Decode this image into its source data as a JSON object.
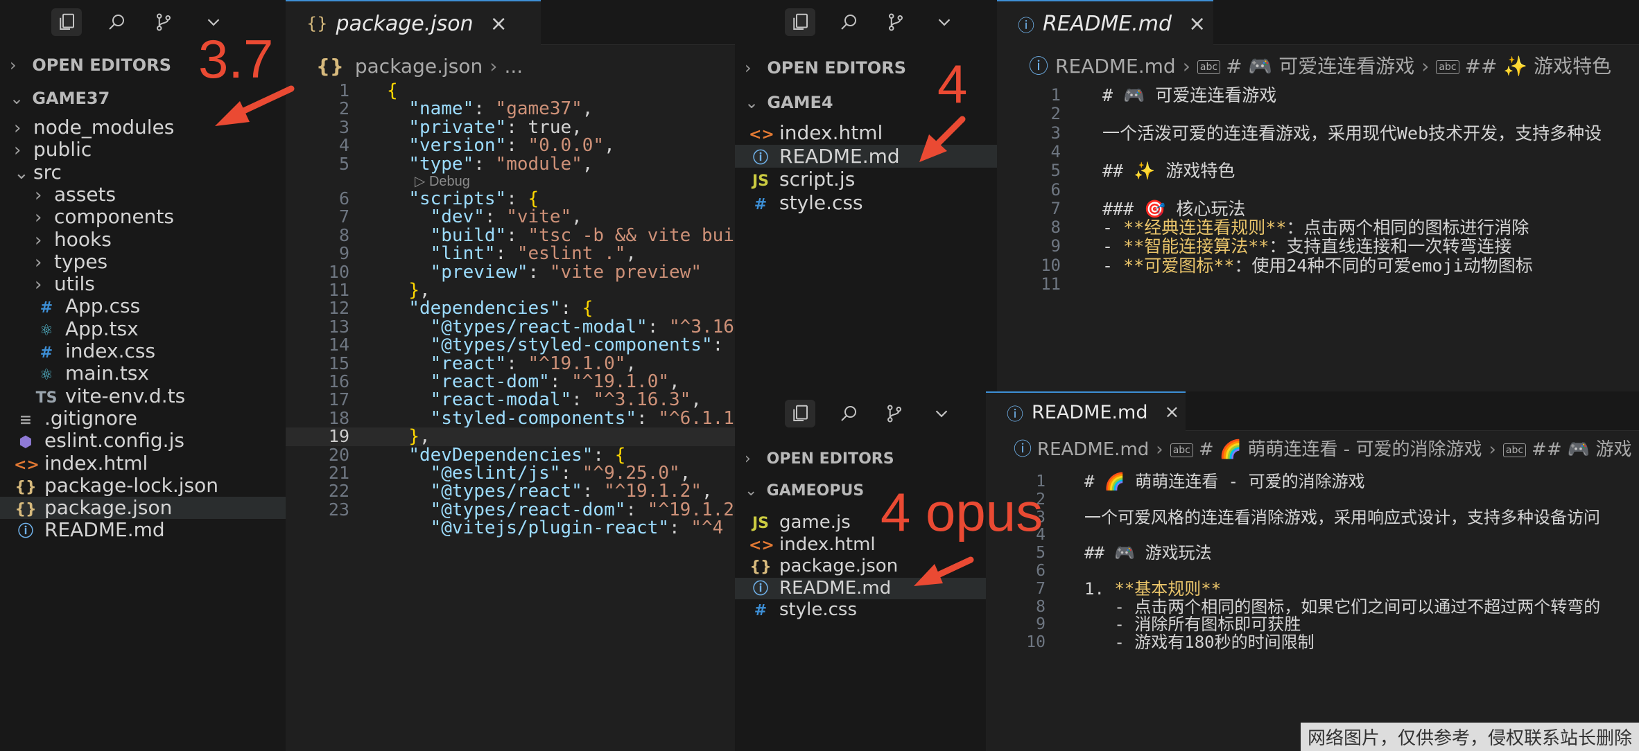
{
  "explorer_left": {
    "open_editors": "OPEN EDITORS",
    "project": "GAME37",
    "rows": [
      {
        "label": "node_modules",
        "icon": "chevron-right",
        "indent": 1
      },
      {
        "label": "public",
        "icon": "chevron-right",
        "indent": 1
      },
      {
        "label": "src",
        "icon": "chevron-down",
        "indent": 1
      },
      {
        "label": "assets",
        "icon": "chevron-right",
        "indent": 2
      },
      {
        "label": "components",
        "icon": "chevron-right",
        "indent": 2
      },
      {
        "label": "hooks",
        "icon": "chevron-right",
        "indent": 2
      },
      {
        "label": "types",
        "icon": "chevron-right",
        "indent": 2
      },
      {
        "label": "utils",
        "icon": "chevron-right",
        "indent": 2
      },
      {
        "label": "App.css",
        "icon": "css",
        "indent": 2
      },
      {
        "label": "App.tsx",
        "icon": "react",
        "indent": 2
      },
      {
        "label": "index.css",
        "icon": "css",
        "indent": 2
      },
      {
        "label": "main.tsx",
        "icon": "react",
        "indent": 2
      },
      {
        "label": "vite-env.d.ts",
        "icon": "ts",
        "indent": 2
      },
      {
        "label": ".gitignore",
        "icon": "lines",
        "indent": 1
      },
      {
        "label": "eslint.config.js",
        "icon": "eslint",
        "indent": 1
      },
      {
        "label": "index.html",
        "icon": "html",
        "indent": 1
      },
      {
        "label": "package-lock.json",
        "icon": "json",
        "indent": 1
      },
      {
        "label": "package.json",
        "icon": "json",
        "indent": 1,
        "selected": true
      },
      {
        "label": "README.md",
        "icon": "info",
        "indent": 1
      }
    ]
  },
  "editor_left": {
    "tab": "package.json",
    "breadcrumb": [
      "package.json",
      "..."
    ],
    "codelens": "Debug",
    "lines": [
      {
        "n": "1",
        "t": "{"
      },
      {
        "n": "2",
        "t": "  \"name\": \"game37\","
      },
      {
        "n": "3",
        "t": "  \"private\": true,"
      },
      {
        "n": "4",
        "t": "  \"version\": \"0.0.0\","
      },
      {
        "n": "5",
        "t": "  \"type\": \"module\","
      },
      {
        "n": "6",
        "t": "  \"scripts\": {"
      },
      {
        "n": "7",
        "t": "    \"dev\": \"vite\","
      },
      {
        "n": "8",
        "t": "    \"build\": \"tsc -b && vite bui"
      },
      {
        "n": "9",
        "t": "    \"lint\": \"eslint .\","
      },
      {
        "n": "10",
        "t": "    \"preview\": \"vite preview\""
      },
      {
        "n": "11",
        "t": "  },"
      },
      {
        "n": "12",
        "t": "  \"dependencies\": {"
      },
      {
        "n": "13",
        "t": "    \"@types/react-modal\": \"^3.16"
      },
      {
        "n": "14",
        "t": "    \"@types/styled-components\":"
      },
      {
        "n": "15",
        "t": "    \"react\": \"^19.1.0\","
      },
      {
        "n": "16",
        "t": "    \"react-dom\": \"^19.1.0\","
      },
      {
        "n": "17",
        "t": "    \"react-modal\": \"^3.16.3\","
      },
      {
        "n": "18",
        "t": "    \"styled-components\": \"^6.1.1"
      },
      {
        "n": "19",
        "t": "  },"
      },
      {
        "n": "20",
        "t": "  \"devDependencies\": {"
      },
      {
        "n": "21",
        "t": "    \"@eslint/js\": \"^9.25.0\","
      },
      {
        "n": "22",
        "t": "    \"@types/react\": \"^19.1.2\","
      },
      {
        "n": "23",
        "t": "    \"@types/react-dom\": \"^19.1.2"
      },
      {
        "n": "",
        "t": "    \"@vitejs/plugin-react\": \"^4"
      }
    ]
  },
  "explorer_top": {
    "open_editors": "OPEN EDITORS",
    "project": "GAME4",
    "rows": [
      {
        "label": "index.html",
        "icon": "html"
      },
      {
        "label": "README.md",
        "icon": "info",
        "selected": true
      },
      {
        "label": "script.js",
        "icon": "js"
      },
      {
        "label": "style.css",
        "icon": "css"
      }
    ]
  },
  "editor_top": {
    "tab": "README.md",
    "breadcrumb": [
      "README.md",
      "# 🎮 可爱连连看游戏",
      "## ✨ 游戏特色"
    ],
    "lines": [
      {
        "n": "1",
        "t": "# 🎮 可爱连连看游戏"
      },
      {
        "n": "2",
        "t": ""
      },
      {
        "n": "3",
        "t": "一个活泼可爱的连连看游戏，采用现代Web技术开发，支持多种设"
      },
      {
        "n": "4",
        "t": ""
      },
      {
        "n": "5",
        "t": "## ✨ 游戏特色"
      },
      {
        "n": "6",
        "t": ""
      },
      {
        "n": "7",
        "t": "### 🎯 核心玩法"
      },
      {
        "n": "8",
        "pre": "- ",
        "b": "**经典连连看规则**",
        "post": "：点击两个相同的图标进行消除"
      },
      {
        "n": "9",
        "pre": "- ",
        "b": "**智能连接算法**",
        "post": "：支持直线连接和一次转弯连接"
      },
      {
        "n": "10",
        "pre": "- ",
        "b": "**可爱图标**",
        "post": "：使用24种不同的可爱emoji动物图标"
      },
      {
        "n": "11",
        "t": ""
      }
    ]
  },
  "explorer_bottom": {
    "open_editors": "OPEN EDITORS",
    "project": "GAMEOPUS",
    "rows": [
      {
        "label": "game.js",
        "icon": "js"
      },
      {
        "label": "index.html",
        "icon": "html"
      },
      {
        "label": "package.json",
        "icon": "json"
      },
      {
        "label": "README.md",
        "icon": "info",
        "selected": true
      },
      {
        "label": "style.css",
        "icon": "css"
      }
    ]
  },
  "editor_bottom": {
    "tab": "README.md",
    "breadcrumb": [
      "README.md",
      "# 🌈 萌萌连连看 - 可爱的消除游戏",
      "## 🎮 游戏"
    ],
    "lines": [
      {
        "n": "1",
        "t": "# 🌈 萌萌连连看 - 可爱的消除游戏"
      },
      {
        "n": "2",
        "t": ""
      },
      {
        "n": "3",
        "t": "一个可爱风格的连连看消除游戏，采用响应式设计，支持多种设备访问"
      },
      {
        "n": "4",
        "t": ""
      },
      {
        "n": "5",
        "t": "## 🎮 游戏玩法"
      },
      {
        "n": "6",
        "t": ""
      },
      {
        "n": "7",
        "pre": "1. ",
        "b": "**基本规则**",
        "post": ""
      },
      {
        "n": "8",
        "t": "   - 点击两个相同的图标，如果它们之间可以通过不超过两个转弯的"
      },
      {
        "n": "9",
        "t": "   - 消除所有图标即可获胜"
      },
      {
        "n": "10",
        "t": "   - 游戏有180秒的时间限制"
      }
    ]
  },
  "annotations": {
    "left": "3.7",
    "top": "4",
    "bottom": "4 opus"
  },
  "watermark": "网络图片，仅供参考，侵权联系站长删除",
  "colors": {
    "accent": "#3d8fd6",
    "annotation": "#ea4a33"
  }
}
